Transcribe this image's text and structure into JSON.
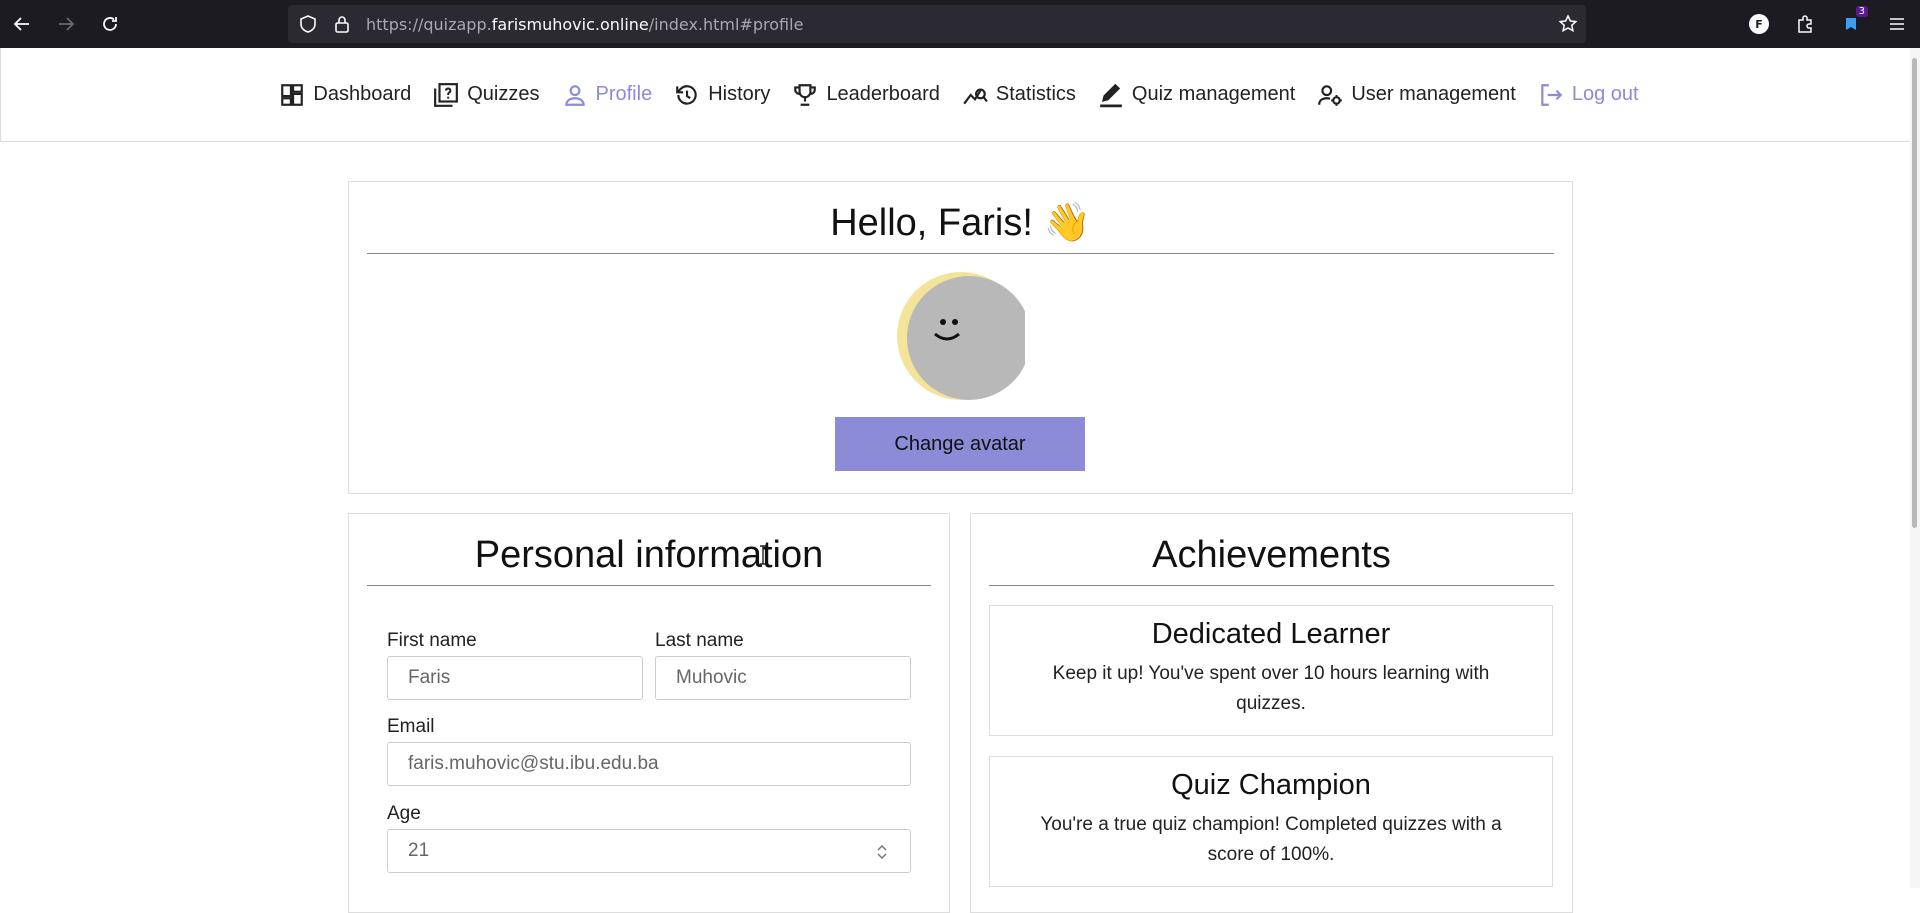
{
  "browser": {
    "url_prefix": "https://quizapp.",
    "url_domain": "farismuhovic.online",
    "url_path": "/index.html#profile",
    "profile_letter": "F",
    "notification_count": "3"
  },
  "nav": {
    "items": [
      {
        "label": "Dashboard",
        "icon": "dashboard-icon"
      },
      {
        "label": "Quizzes",
        "icon": "quiz-icon"
      },
      {
        "label": "Profile",
        "icon": "user-icon",
        "active": true
      },
      {
        "label": "History",
        "icon": "history-icon"
      },
      {
        "label": "Leaderboard",
        "icon": "trophy-icon"
      },
      {
        "label": "Statistics",
        "icon": "statistics-icon"
      },
      {
        "label": "Quiz management",
        "icon": "edit-icon"
      },
      {
        "label": "User management",
        "icon": "user-gear-icon"
      },
      {
        "label": "Log out",
        "icon": "logout-icon"
      }
    ]
  },
  "profile": {
    "greeting": "Hello, Faris! 👋",
    "change_avatar_label": "Change avatar"
  },
  "personal": {
    "title": "Personal information",
    "first_name_label": "First name",
    "first_name_value": "Faris",
    "last_name_label": "Last name",
    "last_name_value": "Muhovic",
    "email_label": "Email",
    "email_value": "faris.muhovic@stu.ibu.edu.ba",
    "age_label": "Age",
    "age_value": "21"
  },
  "achievements": {
    "title": "Achievements",
    "items": [
      {
        "name": "Dedicated Learner",
        "description": "Keep it up! You've spent over 10 hours learning with quizzes."
      },
      {
        "name": "Quiz Champion",
        "description": "You're a true quiz champion! Completed quizzes with a score of 100%."
      }
    ]
  },
  "colors": {
    "accent": "#8b8bd8",
    "browser_bg": "#1c1b22",
    "urlbar_bg": "#2b2a33"
  }
}
